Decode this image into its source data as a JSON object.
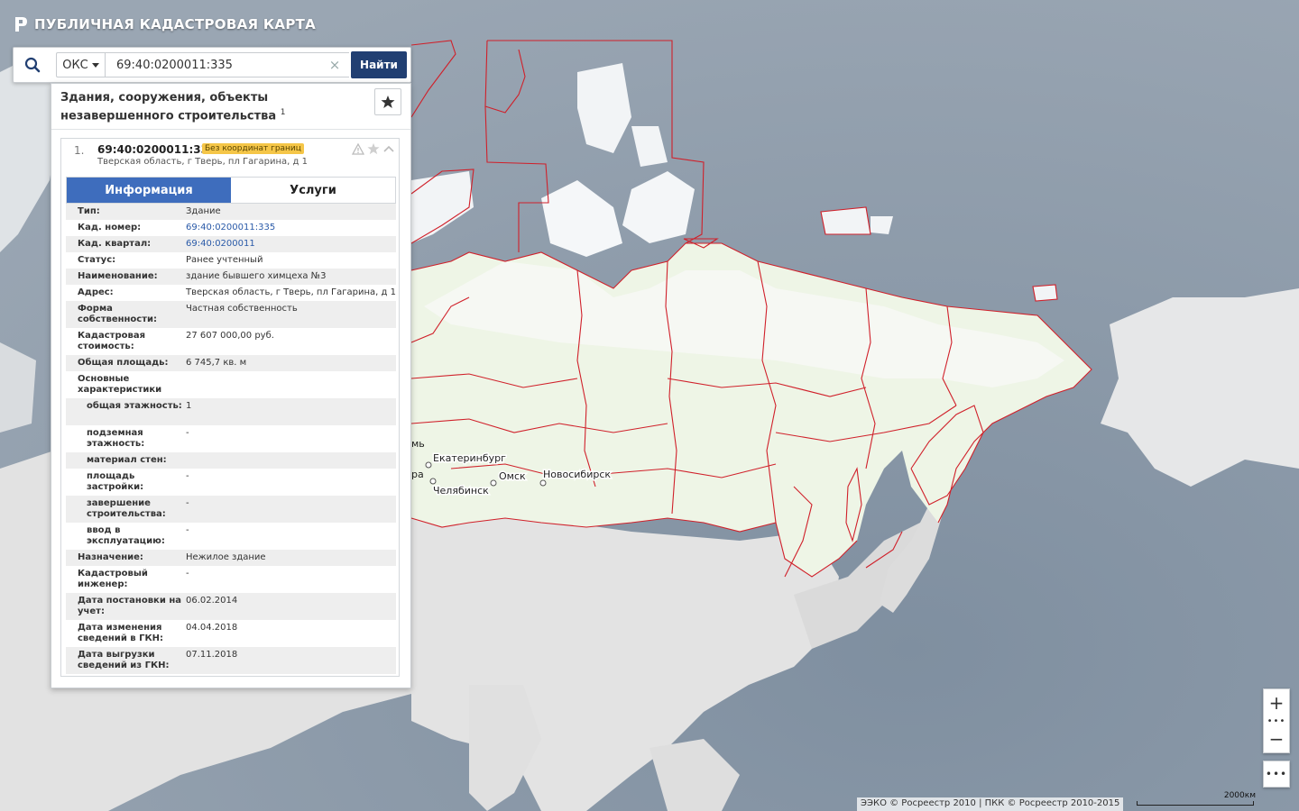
{
  "app": {
    "title": "ПУБЛИЧНАЯ КАДАСТРОВАЯ КАРТА"
  },
  "search": {
    "type_value": "ОКС",
    "query_value": "69:40:0200011:335",
    "clear_glyph": "×",
    "find_label": "Найти"
  },
  "panel": {
    "heading": "Здания, сооружения, объекты незавершенного строительства",
    "count": "1"
  },
  "result": {
    "number": "1.",
    "cad_id": "69:40:0200011:335",
    "badge": "Без координат границ",
    "address": "Тверская область, г Тверь, пл Гагарина, д 1"
  },
  "tabs": [
    {
      "label": "Информация",
      "active": true
    },
    {
      "label": "Услуги",
      "active": false
    }
  ],
  "info": [
    {
      "key": "Тип:",
      "value": "Здание"
    },
    {
      "key": "Кад. номер:",
      "value": "69:40:0200011:335"
    },
    {
      "key": "Кад. квартал:",
      "value": "69:40:0200011"
    },
    {
      "key": "Статус:",
      "value": "Ранее учтенный"
    },
    {
      "key": "Наименование:",
      "value": "здание бывшего химцеха №3"
    },
    {
      "key": "Адрес:",
      "value": "Тверская область, г Тверь, пл Гагарина, д 1"
    },
    {
      "key": "Форма собственности:",
      "value": "Частная собственность"
    },
    {
      "key": "Кадастровая стоимость:",
      "value": "27 607 000,00 руб."
    },
    {
      "key": "Общая площадь:",
      "value": "6 745,7 кв. м"
    },
    {
      "key": "Основные характеристики",
      "value": ""
    },
    {
      "key": "общая этажность:",
      "value": "1"
    },
    {
      "key": "подземная этажность:",
      "value": "-"
    },
    {
      "key": "материал стен:",
      "value": ""
    },
    {
      "key": "площадь застройки:",
      "value": "-"
    },
    {
      "key": "завершение строительства:",
      "value": "-"
    },
    {
      "key": "ввод в эксплуатацию:",
      "value": "-"
    },
    {
      "key": "Назначение:",
      "value": "Нежилое здание"
    },
    {
      "key": "Кадастровый инженер:",
      "value": "-"
    },
    {
      "key": "Дата постановки на учет:",
      "value": "06.02.2014"
    },
    {
      "key": "Дата изменения сведений в ГКН:",
      "value": "04.04.2018"
    },
    {
      "key": "Дата выгрузки сведений из ГКН:",
      "value": "07.11.2018"
    }
  ],
  "map": {
    "cities": [
      "Екатеринбург",
      "Челябинск",
      "Омск",
      "Новосибирск"
    ],
    "partial_labels": [
      "мь",
      "ра"
    ],
    "colors": {
      "sea": "#8d9aa8",
      "russia_land": "#eef5e6",
      "foreign_land": "#e4e4e4",
      "boundary": "#d0202a",
      "ice": "#f3f5f7"
    },
    "zoom_in": "+",
    "zoom_out": "−",
    "dots": "•••",
    "attribution": "ЭЭКО © Росреестр 2010 | ПКК © Росреестр 2010-2015",
    "scale_label": "2000км"
  },
  "icons": [
    "search-icon",
    "chevron-down-icon",
    "close-icon",
    "star-icon",
    "warning-icon",
    "chevron-up-icon",
    "logo-icon",
    "zoom-in-icon",
    "zoom-out-icon",
    "more-icon"
  ]
}
